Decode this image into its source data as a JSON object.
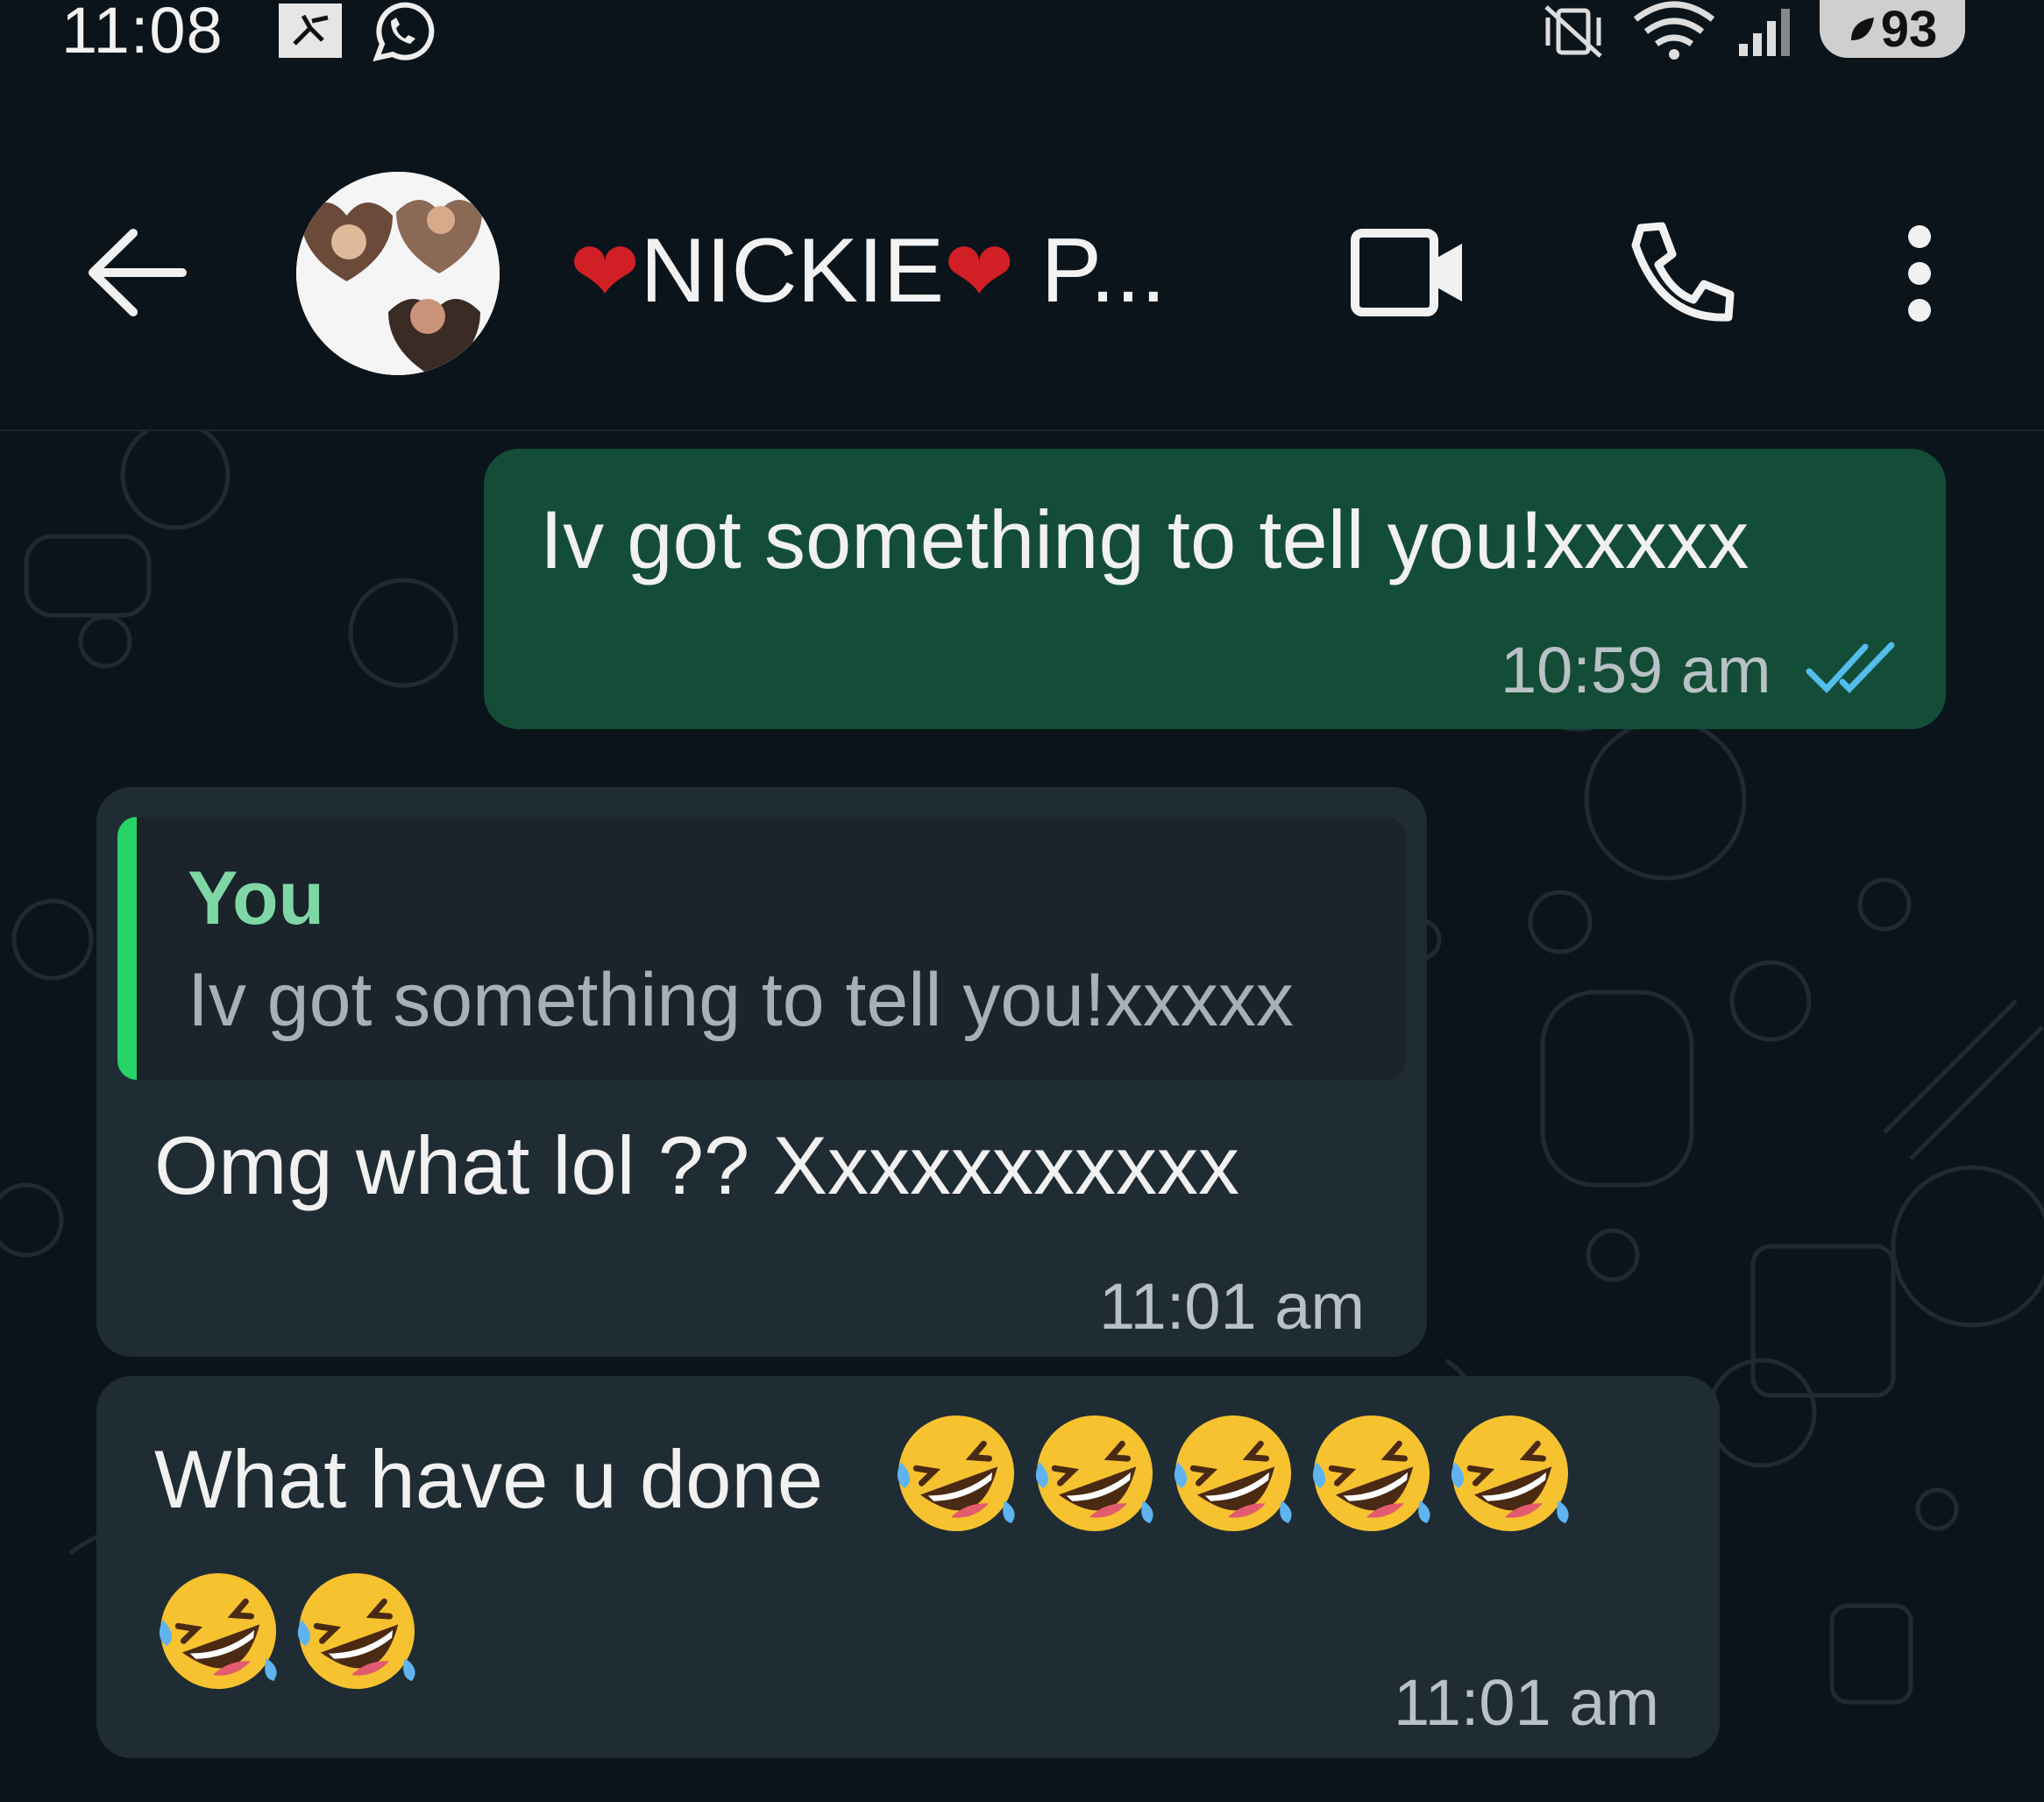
{
  "status_bar": {
    "time": "11:08",
    "battery": "93",
    "icons": [
      "activity-app-icon",
      "whatsapp-icon",
      "vibrate-mute-icon",
      "wifi-icon",
      "signal-icon",
      "battery-saver-icon"
    ]
  },
  "header": {
    "contact_name_part1": "NICKIE",
    "contact_name_part2": "P...",
    "heart": "❤",
    "icons": [
      "back-arrow-icon",
      "video-call-icon",
      "voice-call-icon",
      "more-options-icon"
    ]
  },
  "messages": [
    {
      "direction": "outgoing",
      "text": "Iv got something to tell you!xxxxx",
      "time": "10:59 am",
      "status": "read"
    },
    {
      "direction": "incoming",
      "quote_author": "You",
      "quote_text": "Iv got something to tell you!xxxxx",
      "text": "Omg what lol ?? Xxxxxxxxxxx",
      "time": "11:01 am"
    },
    {
      "direction": "incoming",
      "text": "What have u done",
      "emoji_count": 7,
      "emoji": "rolling-on-floor-laughing",
      "time": "11:01 am"
    }
  ],
  "colors": {
    "background": "#0b141a",
    "outgoing_bubble": "#144d37",
    "incoming_bubble": "#202c33",
    "read_ticks": "#53bdeb",
    "quote_bar": "#25d366"
  }
}
